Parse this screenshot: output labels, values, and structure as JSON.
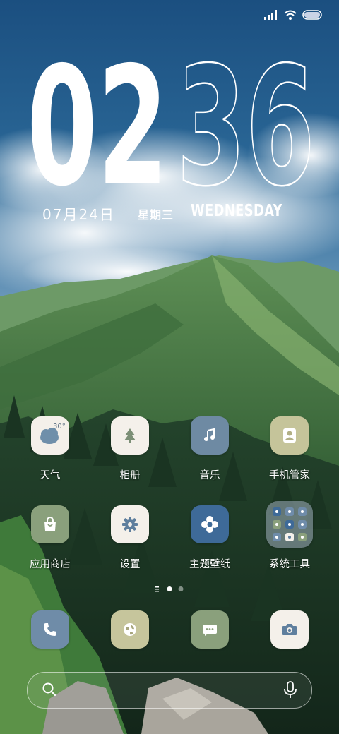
{
  "clock": {
    "hour": "02",
    "minute": "36"
  },
  "date": {
    "text": "07月24日",
    "weekday_cn": "星期三",
    "weekday_en": "WEDNESDAY"
  },
  "weather_widget": {
    "temperature": "30°"
  },
  "apps": [
    {
      "label": "天气",
      "icon": "weather-cloud-icon",
      "color": "#f4f0ea"
    },
    {
      "label": "相册",
      "icon": "tree-icon",
      "color": "#f4f0ea"
    },
    {
      "label": "音乐",
      "icon": "music-note-icon",
      "color": "#6e8aa3"
    },
    {
      "label": "手机管家",
      "icon": "shield-person-icon",
      "color": "#c5c49a"
    },
    {
      "label": "应用商店",
      "icon": "shopping-bag-icon",
      "color": "#8aa07c"
    },
    {
      "label": "设置",
      "icon": "gear-icon",
      "color": "#f4f0ea"
    },
    {
      "label": "主题壁纸",
      "icon": "theme-flower-icon",
      "color": "#3e6a98"
    },
    {
      "label": "系统工具",
      "icon": "folder-icon",
      "color": "#8c9aa6"
    }
  ],
  "dock": [
    {
      "icon": "phone-icon",
      "color": "#6f8ca8"
    },
    {
      "icon": "browser-globe-icon",
      "color": "#c6c59c"
    },
    {
      "icon": "message-icon",
      "color": "#8aa07c"
    },
    {
      "icon": "camera-icon",
      "color": "#f4f0ea"
    }
  ],
  "page_indicator": {
    "pages": 2,
    "current": 1
  },
  "search": {
    "search_icon": "search-icon",
    "voice_icon": "microphone-icon"
  }
}
